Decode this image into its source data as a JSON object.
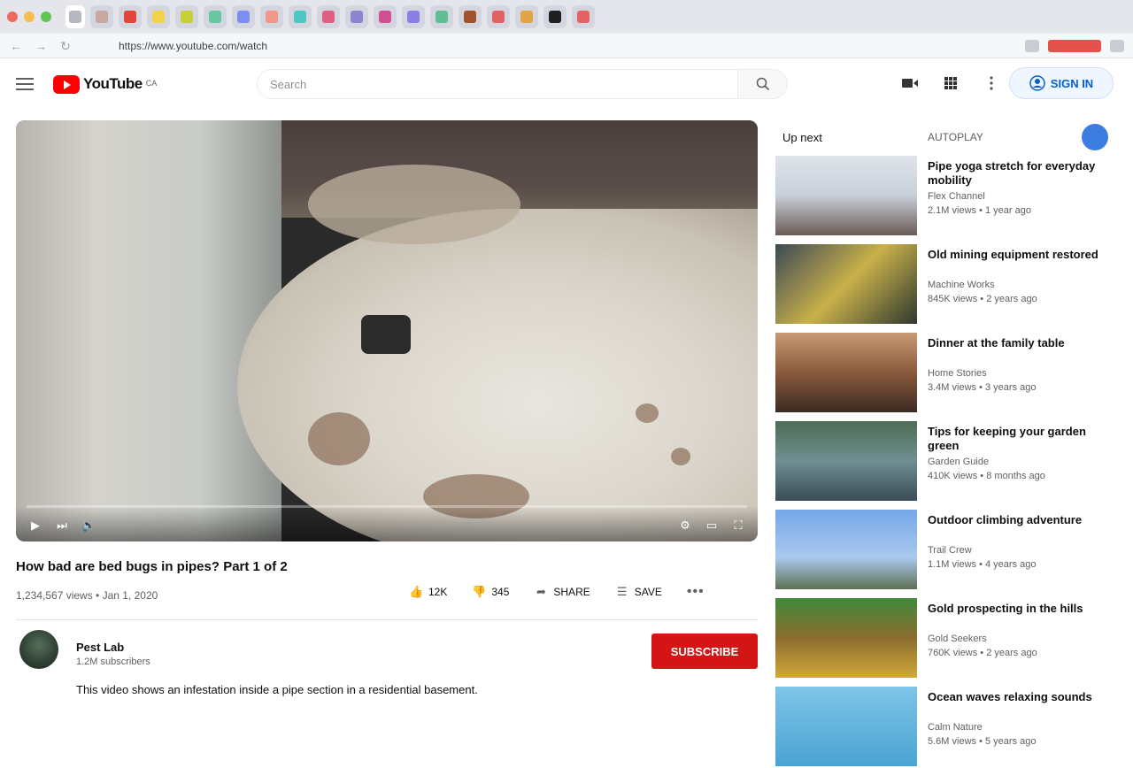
{
  "browser": {
    "url": "https://www.youtube.com/watch",
    "tab_colors": [
      "#b6b8c0",
      "#c7a7a2",
      "#e0463c",
      "#f2d14b",
      "#c8cf38",
      "#67c7a0",
      "#7c8ff0",
      "#f19787",
      "#4cc7c3",
      "#e15e83",
      "#8b84cf",
      "#d24f93",
      "#8d7ee6",
      "#5fbf92",
      "#a0522d",
      "#e16262",
      "#e3a446",
      "#1f1f1f",
      "#e36363"
    ]
  },
  "header": {
    "logo_text": "YouTube",
    "logo_country": "CA",
    "search_placeholder": "Search",
    "signin_label": "SIGN IN"
  },
  "video": {
    "title": "How bad are bed bugs in pipes? Part 1 of 2",
    "stats": "1,234,567 views • Jan 1, 2020",
    "likes": "12K",
    "dislikes": "345",
    "share_label": "SHARE",
    "save_label": "SAVE",
    "more_label": "•••",
    "channel": {
      "name": "Pest Lab",
      "subscribers": "1.2M subscribers"
    },
    "subscribe_label": "SUBSCRIBE",
    "description": "This video shows an infestation inside a pipe section in a residential basement."
  },
  "sidebar": {
    "up_next_label": "Up next",
    "autoplay_label": "AUTOPLAY",
    "recommendations": [
      {
        "title": "Pipe yoga stretch for everyday mobility",
        "channel": "Flex Channel",
        "views": "2.1M views • 1 year ago",
        "thumb": "pink"
      },
      {
        "title": "Old mining equipment restored",
        "channel": "Machine Works",
        "views": "845K views • 2 years ago",
        "thumb": "yellow"
      },
      {
        "title": "Dinner at the family table",
        "channel": "Home Stories",
        "views": "3.4M views • 3 years ago",
        "thumb": "family"
      },
      {
        "title": "Tips for keeping your garden green",
        "channel": "Garden Guide",
        "views": "410K views • 8 months ago",
        "thumb": "teal"
      },
      {
        "title": "Outdoor climbing adventure",
        "channel": "Trail Crew",
        "views": "1.1M views • 4 years ago",
        "thumb": "sky"
      },
      {
        "title": "Gold prospecting in the hills",
        "channel": "Gold Seekers",
        "views": "760K views • 2 years ago",
        "thumb": "gold"
      },
      {
        "title": "Ocean waves relaxing sounds",
        "channel": "Calm Nature",
        "views": "5.6M views • 5 years ago",
        "thumb": "ocean"
      }
    ]
  }
}
